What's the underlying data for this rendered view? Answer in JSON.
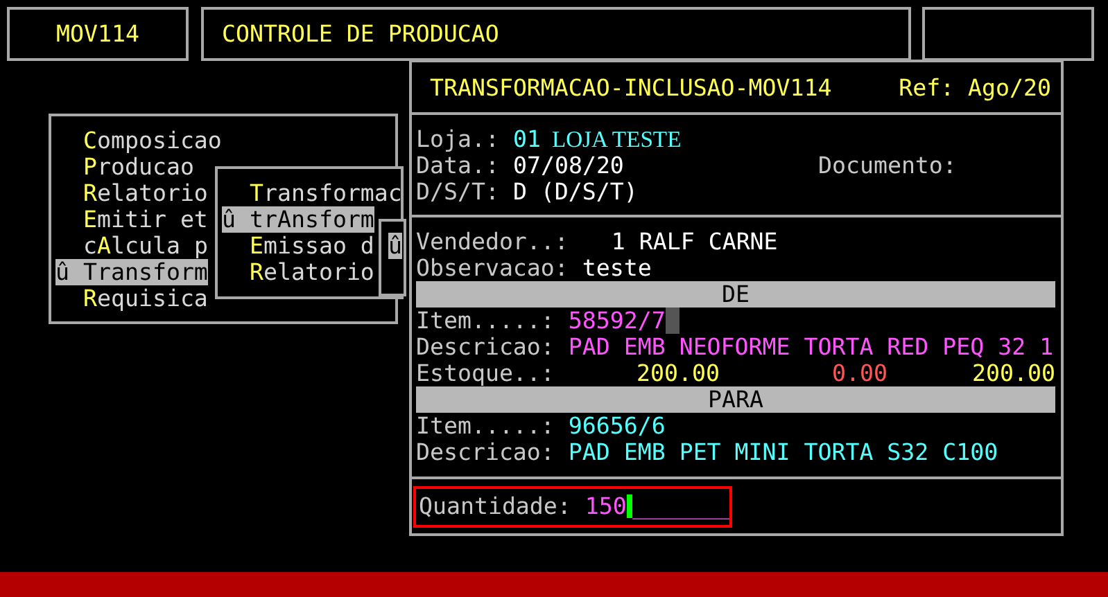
{
  "header": {
    "code": "MOV114",
    "title": "CONTROLE DE PRODUCAO"
  },
  "menu": {
    "items": [
      {
        "key": "C",
        "rest": "omposicao",
        "selected": false
      },
      {
        "key": "P",
        "rest": "roducao",
        "selected": false
      },
      {
        "key": "R",
        "rest": "elatorio",
        "selected": false
      },
      {
        "key": "E",
        "rest": "mitir et",
        "selected": false
      },
      {
        "prefix": "c",
        "key": "A",
        "rest": "lcula p",
        "selected": false
      },
      {
        "marker": "û",
        "key": "T",
        "rest": "ransform",
        "selected": true
      },
      {
        "key": "R",
        "rest": "equisica",
        "selected": false
      }
    ]
  },
  "submenu": {
    "items": [
      {
        "key": "T",
        "rest": "ransformac",
        "selected": false
      },
      {
        "marker": "û",
        "prefix": "tr",
        "key": "A",
        "rest": "nsform",
        "selected": true
      },
      {
        "key": "E",
        "rest": "missao d",
        "selected": false
      },
      {
        "key": "R",
        "rest": "elatorio",
        "selected": false
      }
    ]
  },
  "submenu2": {
    "items": [
      {
        "marker": "û",
        "selected": true
      }
    ]
  },
  "dialog": {
    "title": "TRANSFORMACAO-INCLUSAO-MOV114",
    "ref": "Ref: Ago/20",
    "loja": {
      "label": "Loja.:",
      "code": "01",
      "name": "LOJA TESTE"
    },
    "data": {
      "label": "Data.:",
      "value": "07/08/20"
    },
    "documento": {
      "label": "Documento:"
    },
    "dst": {
      "label": "D/S/T:",
      "value": "D (D/S/T)"
    },
    "vendedor": {
      "label": "Vendedor..:",
      "value": "1 RALF CARNE"
    },
    "observacao": {
      "label": "Observacao:",
      "value": "teste"
    },
    "from": {
      "heading": "DE",
      "item_label": "Item.....:",
      "item": "58592/7",
      "desc_label": "Descricao:",
      "desc": "PAD EMB NEOFORME TORTA RED PEQ 32 1",
      "stock_label": "Estoque..:",
      "stock": [
        {
          "value": "200.00",
          "color": "#ffff55"
        },
        {
          "value": "0.00",
          "color": "#ff5555"
        },
        {
          "value": "200.00",
          "color": "#ffff55"
        }
      ]
    },
    "to": {
      "heading": "PARA",
      "item_label": "Item.....:",
      "item": "96656/6",
      "desc_label": "Descricao:",
      "desc": "PAD EMB PET MINI TORTA S32 C100"
    },
    "quantity": {
      "label": "Quantidade:",
      "value": "150",
      "blank": "_______"
    }
  }
}
